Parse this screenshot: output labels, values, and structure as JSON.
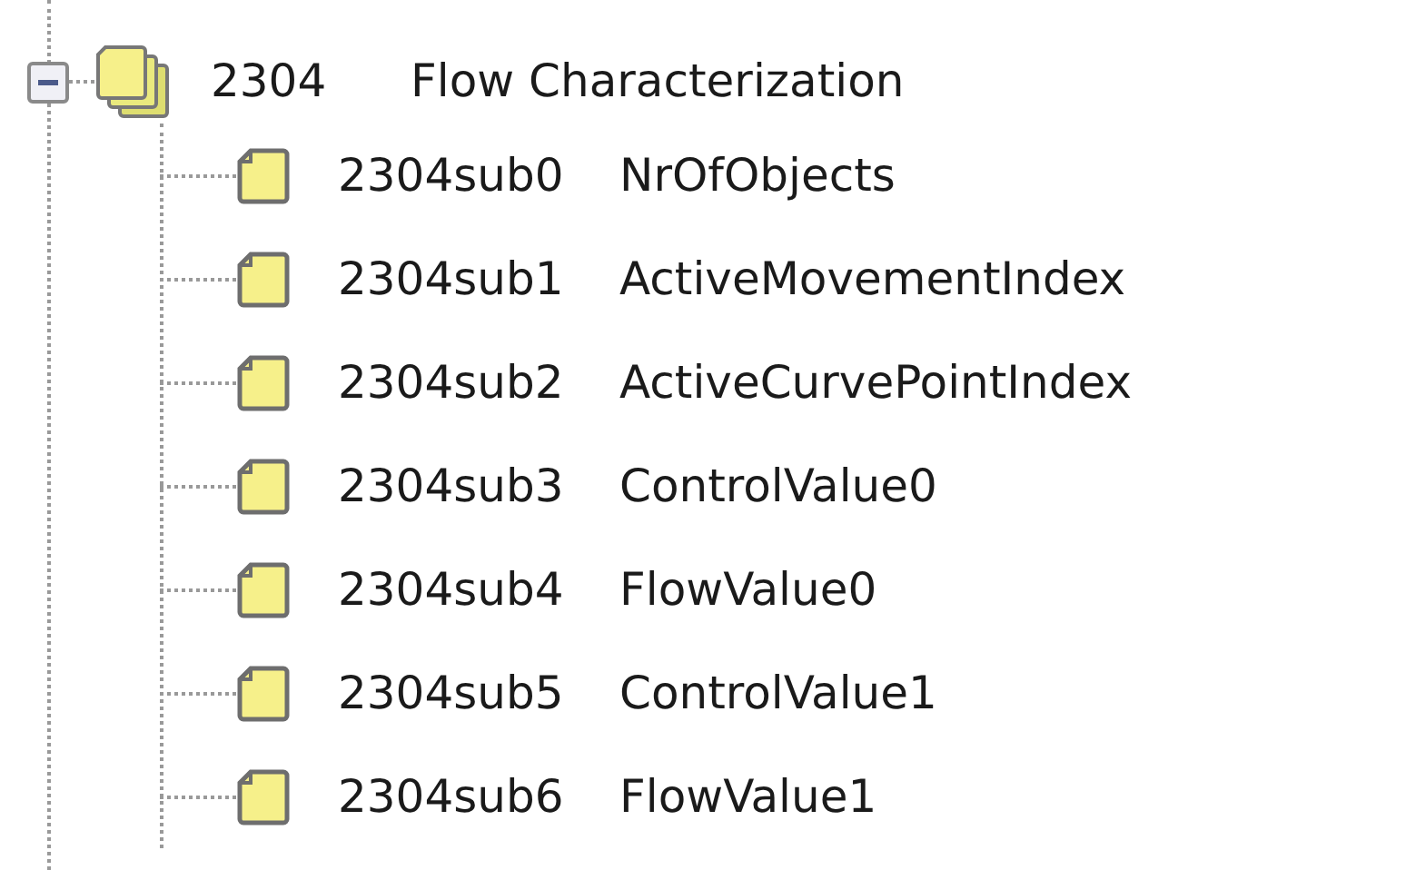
{
  "tree": {
    "index": "2304",
    "name": "Flow Characterization",
    "expanded": true,
    "children": [
      {
        "index": "2304sub0",
        "name": "NrOfObjects"
      },
      {
        "index": "2304sub1",
        "name": "ActiveMovementIndex"
      },
      {
        "index": "2304sub2",
        "name": "ActiveCurvePointIndex"
      },
      {
        "index": "2304sub3",
        "name": "ControlValue0"
      },
      {
        "index": "2304sub4",
        "name": "FlowValue0"
      },
      {
        "index": "2304sub5",
        "name": "ControlValue1"
      },
      {
        "index": "2304sub6",
        "name": "FlowValue1"
      }
    ]
  }
}
